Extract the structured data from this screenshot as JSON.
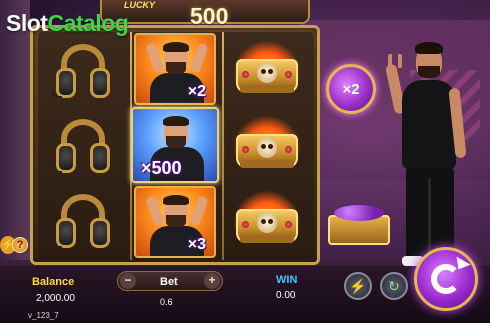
{
  "watermark": {
    "part1": "Slot",
    "part2": "Catalog"
  },
  "banner": {
    "lucky": "LUCKY",
    "amount": "500"
  },
  "reels": {
    "columns": [
      {
        "symbols": [
          "headphones",
          "headphones",
          "headphones"
        ]
      },
      {
        "symbols": [
          "person-multiplier",
          "person-multiplier",
          "person-multiplier"
        ],
        "multipliers": [
          "×2",
          "×500",
          "×3"
        ]
      },
      {
        "symbols": [
          "crown",
          "crown",
          "crown"
        ]
      }
    ]
  },
  "side_orb": {
    "label": "×2"
  },
  "bottom": {
    "balance_label": "Balance",
    "balance_value": "2,000.00",
    "bet_label": "Bet",
    "bet_value": "0.6",
    "bet_minus": "−",
    "bet_plus": "+",
    "win_label": "WIN",
    "win_value": "0.00",
    "version": "v_123_7"
  },
  "icons": {
    "turbo": "⚡",
    "auto": "↻",
    "lightning": "⚡",
    "help": "?"
  },
  "colors": {
    "logo_green": "#3fd24a",
    "balance_label": "#ffd84a",
    "win_label": "#3ac8ff",
    "spin_purple": "#9a2ad0"
  }
}
